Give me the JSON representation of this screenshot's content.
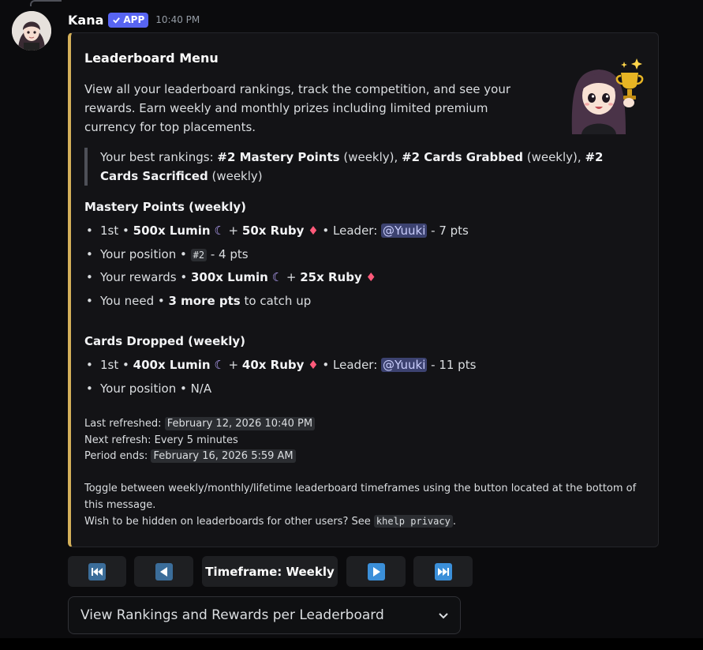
{
  "message": {
    "username": "Kana",
    "app_badge": "APP",
    "timestamp": "10:40 PM"
  },
  "embed": {
    "accent_color": "#d4b05a",
    "title": "Leaderboard Menu",
    "description": "View all your leaderboard rankings, track the competition, and see your rewards. Earn weekly and monthly prizes including limited premium currency for top placements.",
    "best_rankings": {
      "prefix": "Your best rankings:",
      "items": [
        {
          "bold": "#2 Mastery Points",
          "suffix": "(weekly),"
        },
        {
          "bold": "#2 Cards Grabbed",
          "suffix": "(weekly),"
        },
        {
          "bold": "#2 Cards Sacrificed",
          "suffix": "(weekly)"
        }
      ]
    },
    "sections": [
      {
        "title": "Mastery Points (weekly)",
        "first_prefix": "1st •",
        "first_lumin": "500x Lumin",
        "first_ruby": "50x Ruby",
        "leader_label": "• Leader:",
        "leader": "@Yuuki",
        "leader_score": "- 7 pts",
        "position_prefix": "Your position •",
        "position_rank": "#2",
        "position_score": "- 4 pts",
        "rewards_prefix": "Your rewards •",
        "rewards_lumin": "300x Lumin",
        "rewards_ruby": "25x Ruby",
        "need_prefix": "You need •",
        "need_amount": "3 more pts",
        "need_suffix": "to catch up"
      },
      {
        "title": "Cards Dropped (weekly)",
        "first_prefix": "1st •",
        "first_lumin": "400x Lumin",
        "first_ruby": "40x Ruby",
        "leader_label": "• Leader:",
        "leader": "@Yuuki",
        "leader_score": "- 11 pts",
        "position_text": "Your position • N/A"
      }
    ],
    "footer": {
      "last_refreshed_label": "Last refreshed:",
      "last_refreshed_value": "February 12, 2026 10:40 PM",
      "next_refresh": "Next refresh: Every 5 minutes",
      "period_ends_label": "Period ends:",
      "period_ends_value": "February 16, 2026 5:59 AM",
      "toggle_line1": "Toggle between weekly/monthly/lifetime leaderboard timeframes using the button located at the bottom of",
      "toggle_line2": "this message.",
      "privacy_prefix": "Wish to be hidden on leaderboards for other users? See",
      "privacy_command": "khelp privacy",
      "privacy_suffix": "."
    }
  },
  "buttons": {
    "first_icon": "skip-to-first-icon",
    "prev_icon": "previous-arrow-icon",
    "timeframe_label": "Timeframe: Weekly",
    "next_icon": "next-arrow-icon",
    "last_icon": "skip-to-last-icon"
  },
  "select_menu": {
    "label": "View Rankings and Rewards per Leaderboard"
  }
}
